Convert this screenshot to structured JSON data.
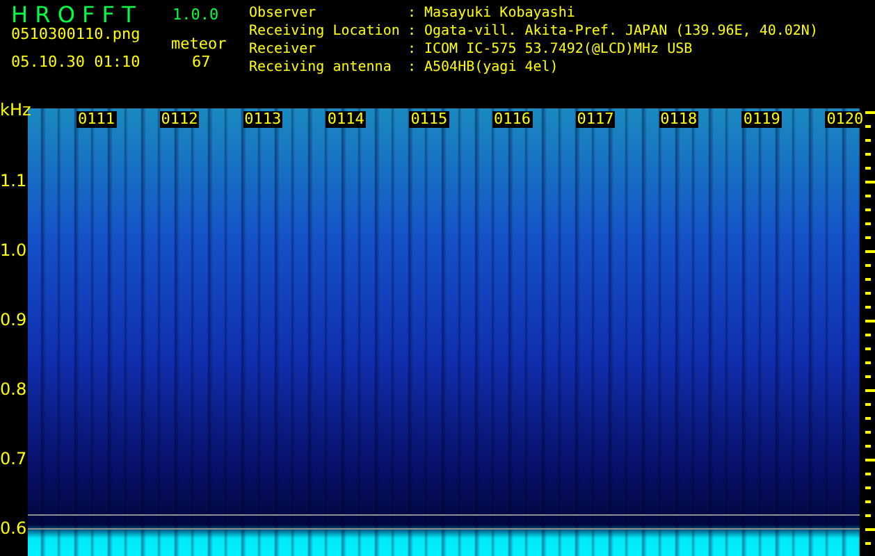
{
  "app": {
    "name": "H R O F F T",
    "version": "1.0.0"
  },
  "file": "0510300110.png",
  "timestamp": "05.10.30 01:10",
  "meteor": {
    "label": "meteor",
    "count": "67"
  },
  "info": [
    {
      "label": "Observer",
      "separator": ":",
      "value": "Masayuki Kobayashi"
    },
    {
      "label": "Receiving Location",
      "separator": ":",
      "value": "Ogata-vill. Akita-Pref. JAPAN (139.96E, 40.02N)"
    },
    {
      "label": "Receiver",
      "separator": ":",
      "value": "ICOM IC-575 53.7492(@LCD)MHz USB"
    },
    {
      "label": "Receiving antenna",
      "separator": ":",
      "value": "A504HB(yagi 4el)"
    }
  ],
  "spectrogram": {
    "unit": "kHz",
    "frequency_labels": [
      "1.1",
      "1.0",
      "0.9",
      "0.8",
      "0.7",
      "0.6"
    ],
    "time_labels": [
      "0111",
      "0112",
      "0113",
      "0114",
      "0115",
      "0116",
      "0117",
      "0118",
      "0119",
      "0120"
    ]
  }
}
